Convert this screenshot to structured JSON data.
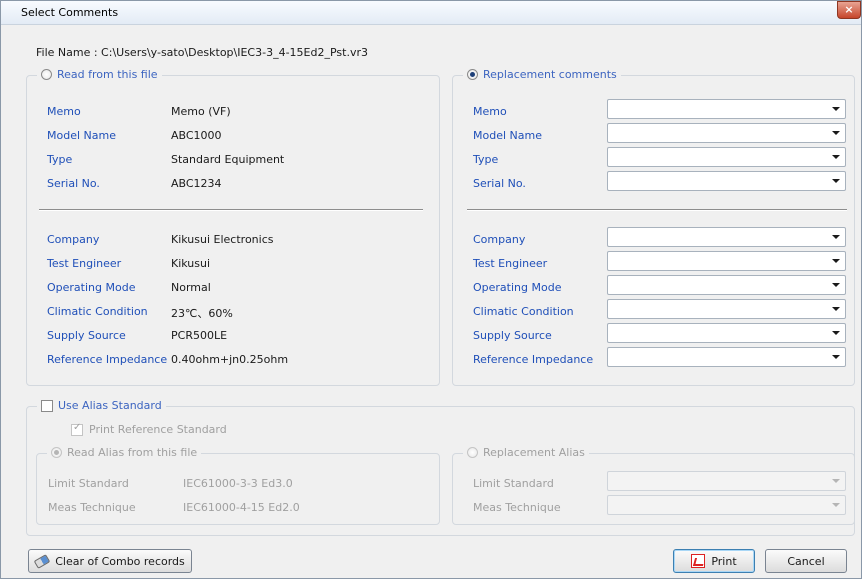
{
  "window": {
    "title": "Select Comments",
    "close": "×"
  },
  "file_name": "File Name : C:\\Users\\y-sato\\Desktop\\IEC3-3_4-15Ed2_Pst.vr3",
  "read_from_file": {
    "label": "Read from this file",
    "rows_top": [
      {
        "label": "Memo",
        "value": "Memo (VF)"
      },
      {
        "label": "Model Name",
        "value": "ABC1000"
      },
      {
        "label": "Type",
        "value": "Standard Equipment"
      },
      {
        "label": "Serial No.",
        "value": "ABC1234"
      }
    ],
    "rows_bottom": [
      {
        "label": "Company",
        "value": "Kikusui Electronics"
      },
      {
        "label": "Test Engineer",
        "value": "Kikusui"
      },
      {
        "label": "Operating Mode",
        "value": "Normal"
      },
      {
        "label": "Climatic Condition",
        "value": "23℃、60%"
      },
      {
        "label": "Supply Source",
        "value": "PCR500LE"
      },
      {
        "label": "Reference Impedance",
        "value": "0.40ohm+jn0.25ohm"
      }
    ]
  },
  "replacement": {
    "label": "Replacement comments",
    "rows_top": [
      "Memo",
      "Model Name",
      "Type",
      "Serial No."
    ],
    "rows_bottom": [
      "Company",
      "Test Engineer",
      "Operating Mode",
      "Climatic Condition",
      "Supply Source",
      "Reference Impedance"
    ]
  },
  "alias": {
    "use_alias_label": "Use Alias Standard",
    "print_reference_label": "Print Reference Standard",
    "read_alias_label": "Read Alias from this file",
    "replacement_alias_label": "Replacement Alias",
    "limit_standard_label": "Limit Standard",
    "limit_standard_value": "IEC61000-3-3 Ed3.0",
    "meas_technique_label": "Meas Technique",
    "meas_technique_value": "IEC61000-4-15 Ed2.0"
  },
  "buttons": {
    "clear": "Clear of Combo records",
    "print": "Print",
    "cancel": "Cancel"
  }
}
